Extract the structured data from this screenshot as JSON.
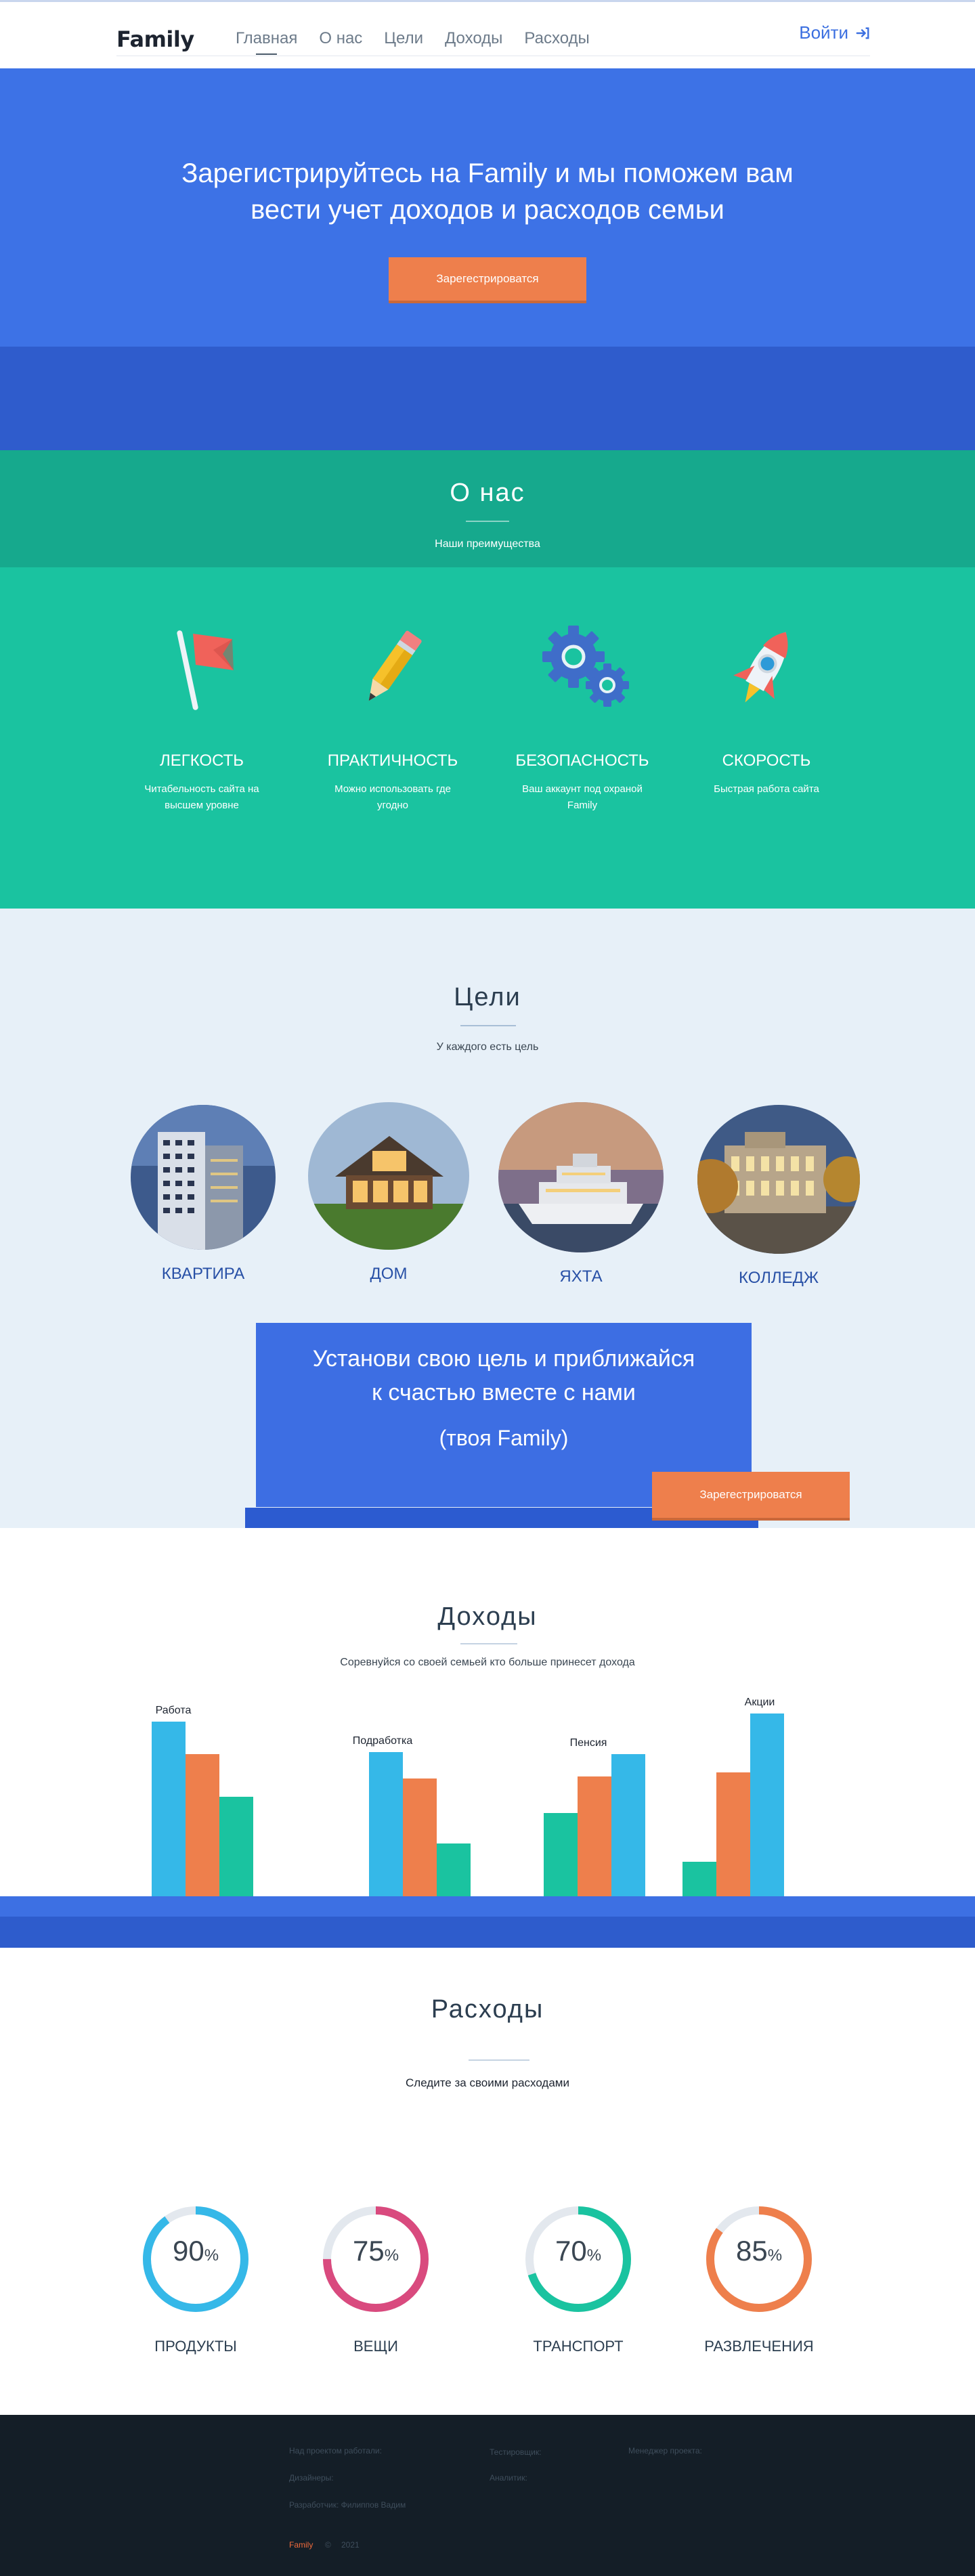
{
  "header": {
    "logo": "Family",
    "nav": [
      "Главная",
      "О нас",
      "Цели",
      "Доходы",
      "Расходы"
    ],
    "login": "Войти"
  },
  "hero": {
    "title_line1": "Зарегистрируйтесь на Family и мы поможем вам",
    "title_line2": "вести учет доходов и расходов семьи",
    "button": "Зарегестрироватся"
  },
  "about": {
    "title": "О нас",
    "subtitle": "Наши преимущества",
    "features": [
      {
        "title": "ЛЕГКОСТЬ",
        "line1": "Читабельность сайта на",
        "line2": "высшем уровне",
        "icon": "flag-icon"
      },
      {
        "title": "ПРАКТИЧНОСТЬ",
        "line1": "Можно использовать где",
        "line2": "угодно",
        "icon": "pencil-icon"
      },
      {
        "title": "БЕЗОПАСНОСТЬ",
        "line1": "Ваш аккаунт под охраной",
        "line2": "Family",
        "icon": "gears-icon"
      },
      {
        "title": "СКОРОСТЬ",
        "line1": "Быстрая работа сайта",
        "line2": "",
        "icon": "rocket-icon"
      }
    ]
  },
  "goals": {
    "title": "Цели",
    "subtitle": "У каждого есть цель",
    "items": [
      "КВАРТИРА",
      "ДОМ",
      "ЯХТА",
      "КОЛЛЕДЖ"
    ],
    "cta_line1": "Установи свою цель и приближайся",
    "cta_line2": "к счастью вместе с нами",
    "cta_brand": "(твоя Family)",
    "button": "Зарегестрироватся"
  },
  "income": {
    "title": "Доходы",
    "subtitle": "Соревнуйся со своей семьей кто больше принесет дохода",
    "colors": {
      "blue": "#35b8e8",
      "orange": "#ee7f4c",
      "green": "#1ac3a0"
    }
  },
  "chart_data": {
    "type": "bar",
    "categories": [
      "Работа",
      "Подработка",
      "Пенсия",
      "Акции"
    ],
    "series": [
      {
        "values": [
          86,
          71,
          70,
          90
        ]
      },
      {
        "values": [
          70,
          58,
          59,
          61
        ]
      },
      {
        "values": [
          49,
          26,
          41,
          17
        ]
      }
    ],
    "ylim": [
      0,
      100
    ],
    "grid": false
  },
  "expenses": {
    "title": "Расходы",
    "subtitle": "Следите за своими расходами",
    "items": [
      {
        "label": "ПРОДУКТЫ",
        "value": 90,
        "unit": "%",
        "color": "#35b8e8"
      },
      {
        "label": "ВЕЩИ",
        "value": 75,
        "unit": "%",
        "color": "#d94a7e"
      },
      {
        "label": "ТРАНСПОРТ",
        "value": 70,
        "unit": "%",
        "color": "#1ac3a0"
      },
      {
        "label": "РАЗВЛЕЧЕНИЯ",
        "value": 85,
        "unit": "%",
        "color": "#ee7f4c"
      }
    ]
  },
  "footer": {
    "col1": [
      "Над проектом работали:",
      "Дизайнеры:",
      "Разработчик: Филиппов Вадим"
    ],
    "col2": [
      "Тестировщик:",
      "Аналитик:"
    ],
    "col3": [
      "Менеджер проекта:"
    ],
    "brand": "Family",
    "copy": "©",
    "year": "2021"
  }
}
